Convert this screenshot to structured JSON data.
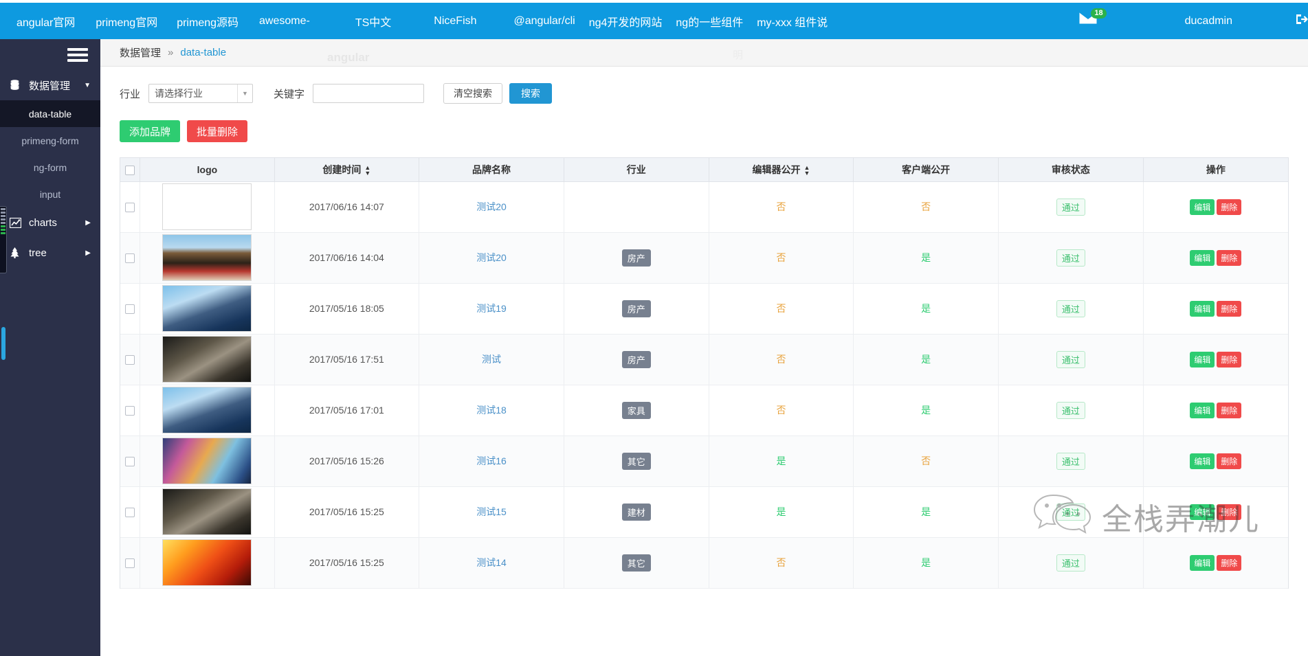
{
  "topnav": {
    "links": [
      {
        "label": "angular官网"
      },
      {
        "label": "primeng官网"
      },
      {
        "label": "primeng源码"
      },
      {
        "label": "awesome-"
      },
      {
        "label": "TS中文"
      },
      {
        "label": "NiceFish"
      },
      {
        "label": "@angular/cli"
      },
      {
        "label": "ng4开发的网站"
      },
      {
        "label": "ng的一些组件"
      },
      {
        "label": "my-xxx 组件说"
      }
    ],
    "mail_icon": "envelope-icon",
    "mail_badge": "18",
    "username": "ducadmin",
    "logout_icon": "logout-icon",
    "background": "#0e9ae0"
  },
  "sidebar": {
    "toggle_icon": "hamburger-icon",
    "group": {
      "label": "数据管理",
      "icon": "database-icon",
      "caret_icon": "chevron-down-icon"
    },
    "items": [
      {
        "label": "data-table",
        "active": true
      },
      {
        "label": "primeng-form",
        "active": false
      },
      {
        "label": "ng-form",
        "active": false
      },
      {
        "label": "input",
        "active": false
      }
    ],
    "groups2": [
      {
        "label": "charts",
        "icon": "chart-line-icon",
        "caret_icon": "chevron-right-icon"
      },
      {
        "label": "tree",
        "icon": "tree-icon",
        "caret_icon": "chevron-right-icon"
      }
    ]
  },
  "breadcrumb": {
    "root": "数据管理",
    "separator": "»",
    "current": "data-table",
    "watermark": "angular",
    "watermark2": "明"
  },
  "search": {
    "industry_label": "行业",
    "industry_value": "请选择行业",
    "dropdown_icon": "chevron-down-icon",
    "keyword_label": "关键字",
    "keyword_value": "",
    "keyword_placeholder": "",
    "clear_label": "清空搜索",
    "search_label": "搜索"
  },
  "actions": {
    "add_label": "添加品牌",
    "batch_delete_label": "批量删除"
  },
  "table": {
    "columns": [
      {
        "label": "",
        "sortable": false,
        "key": "check"
      },
      {
        "label": "logo",
        "sortable": false,
        "key": "logo"
      },
      {
        "label": "创建时间",
        "sortable": true,
        "key": "created"
      },
      {
        "label": "品牌名称",
        "sortable": false,
        "key": "brand"
      },
      {
        "label": "行业",
        "sortable": false,
        "key": "industry"
      },
      {
        "label": "编辑器公开",
        "sortable": true,
        "key": "editor_public"
      },
      {
        "label": "客户端公开",
        "sortable": false,
        "key": "client_public"
      },
      {
        "label": "审核状态",
        "sortable": false,
        "key": "audit"
      },
      {
        "label": "操作",
        "sortable": false,
        "key": "ops"
      }
    ],
    "edit_label": "编辑",
    "delete_label": "删除",
    "rows": [
      {
        "img": "blank",
        "created": "2017/06/16 14:07",
        "brand": "测试20",
        "industry": "",
        "editor_public": "否",
        "client_public": "否",
        "audit": "通过"
      },
      {
        "img": "anime",
        "created": "2017/06/16 14:04",
        "brand": "测试20",
        "industry": "房产",
        "editor_public": "否",
        "client_public": "是",
        "audit": "通过"
      },
      {
        "img": "tower",
        "created": "2017/05/16 18:05",
        "brand": "测试19",
        "industry": "房产",
        "editor_public": "否",
        "client_public": "是",
        "audit": "通过"
      },
      {
        "img": "no",
        "created": "2017/05/16 17:51",
        "brand": "测试",
        "industry": "房产",
        "editor_public": "否",
        "client_public": "是",
        "audit": "通过"
      },
      {
        "img": "tower",
        "created": "2017/05/16 17:01",
        "brand": "测试18",
        "industry": "家具",
        "editor_public": "否",
        "client_public": "是",
        "audit": "通过"
      },
      {
        "img": "city",
        "created": "2017/05/16 15:26",
        "brand": "测试16",
        "industry": "其它",
        "editor_public": "是",
        "client_public": "否",
        "audit": "通过"
      },
      {
        "img": "no",
        "created": "2017/05/16 15:25",
        "brand": "测试15",
        "industry": "建材",
        "editor_public": "是",
        "client_public": "是",
        "audit": "通过"
      },
      {
        "img": "fire",
        "created": "2017/05/16 15:25",
        "brand": "测试14",
        "industry": "其它",
        "editor_public": "否",
        "client_public": "是",
        "audit": "通过"
      }
    ]
  },
  "watermark": {
    "icon": "wechat-icon",
    "text": "全栈弄潮儿"
  },
  "colors": {
    "accent": "#0e9ae0",
    "sidebar": "#2b3049",
    "success": "#2ecc71",
    "danger": "#f04a4a",
    "warning": "#e8a33d",
    "link": "#4a90c8"
  }
}
